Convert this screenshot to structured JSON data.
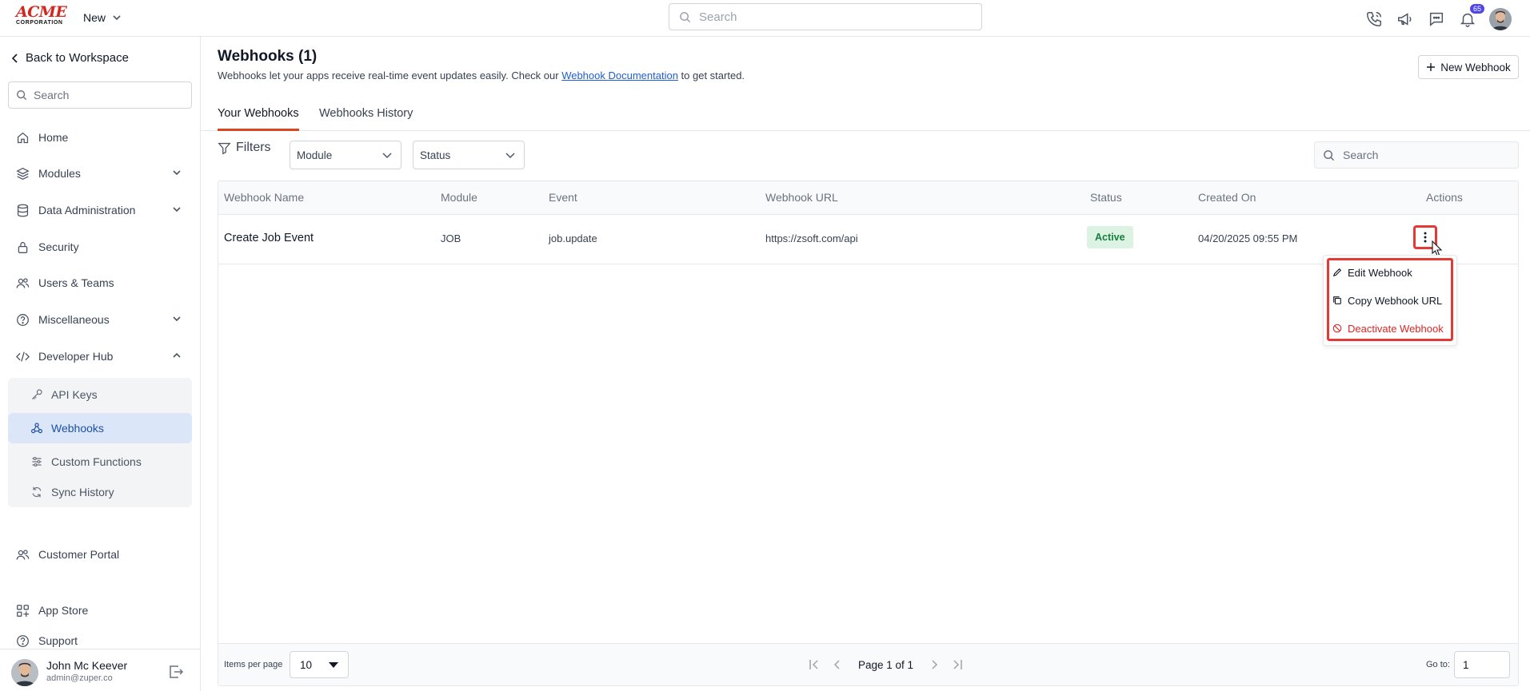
{
  "brand": {
    "logo_line1": "ACME",
    "logo_line2": "CORPORATION",
    "accent": "#d4261c"
  },
  "topbar": {
    "new_label": "New",
    "search_placeholder": "Search",
    "notification_count": "65"
  },
  "sidebar": {
    "back_label": "Back to Workspace",
    "search_placeholder": "Search",
    "items": [
      {
        "label": "Home",
        "icon": "home-icon"
      },
      {
        "label": "Modules",
        "icon": "layers-icon",
        "chevron": "down"
      },
      {
        "label": "Data Administration",
        "icon": "database-icon",
        "chevron": "down"
      },
      {
        "label": "Security",
        "icon": "lock-icon"
      },
      {
        "label": "Users & Teams",
        "icon": "users-icon"
      },
      {
        "label": "Miscellaneous",
        "icon": "help-circle-icon",
        "chevron": "down"
      },
      {
        "label": "Developer Hub",
        "icon": "code-icon",
        "chevron": "up"
      }
    ],
    "developer_hub_items": [
      {
        "label": "API Keys",
        "icon": "key-icon"
      },
      {
        "label": "Webhooks",
        "icon": "webhook-icon",
        "active": true
      },
      {
        "label": "Custom Functions",
        "icon": "sliders-icon"
      },
      {
        "label": "Sync History",
        "icon": "sync-icon"
      }
    ],
    "bottom_items": [
      {
        "label": "Customer Portal",
        "icon": "users-icon"
      },
      {
        "label": "App Store",
        "icon": "grid-plus-icon"
      },
      {
        "label": "Support",
        "icon": "help-circle-icon"
      }
    ],
    "user": {
      "name": "John Mc Keever",
      "email": "admin@zuper.co"
    }
  },
  "main": {
    "title": "Webhooks (1)",
    "description_prefix": "Webhooks let your apps receive real-time event updates easily. Check our ",
    "description_link": "Webhook Documentation",
    "description_suffix": " to get started.",
    "new_webhook_label": "New Webhook",
    "tabs": [
      {
        "label": "Your Webhooks",
        "active": true
      },
      {
        "label": "Webhooks History",
        "active": false
      }
    ],
    "filters_label": "Filters",
    "module_dropdown": "Module",
    "status_dropdown": "Status",
    "table_search_placeholder": "Search"
  },
  "table": {
    "columns": [
      "Webhook Name",
      "Module",
      "Event",
      "Webhook URL",
      "Status",
      "Created On",
      "Actions"
    ],
    "rows": [
      {
        "name": "Create Job Event",
        "module": "JOB",
        "event": "job.update",
        "url": "https://zsoft.com/api",
        "status": "Active",
        "created_on": "04/20/2025 09:55 PM"
      }
    ],
    "actions_menu": [
      {
        "label": "Edit Webhook",
        "icon": "pencil-icon"
      },
      {
        "label": "Copy Webhook URL",
        "icon": "copy-icon"
      },
      {
        "label": "Deactivate Webhook",
        "icon": "ban-icon",
        "danger": true
      }
    ],
    "footer": {
      "items_per_page_label": "Items per page",
      "items_per_page_value": "10",
      "page_text": "Page 1 of 1",
      "goto_label": "Go to:",
      "goto_value": "1"
    }
  },
  "colors": {
    "status_active_bg": "#dcf3e4",
    "status_active_text": "#16803c",
    "tab_underline": "#d9461f",
    "highlight_border": "#e53935",
    "danger": "#dc2626",
    "link": "#1d5fd1",
    "active_nav_bg": "#dbe7f8"
  }
}
